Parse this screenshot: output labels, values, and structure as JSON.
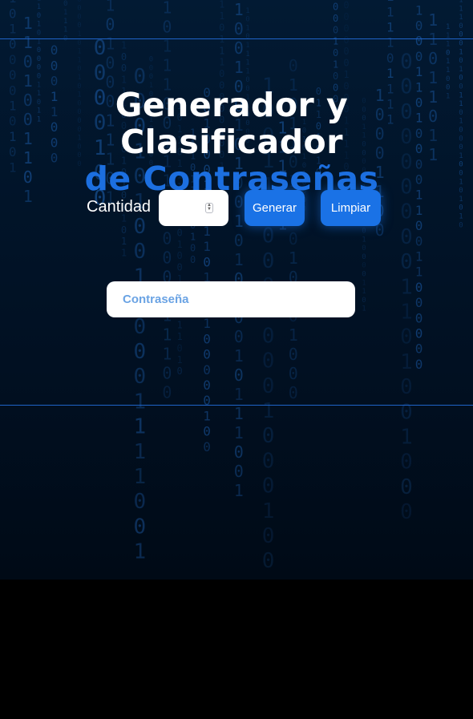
{
  "title": {
    "line1": "Generador y Clasificador",
    "line2": "de Contraseñas"
  },
  "controls": {
    "quantity_label": "Cantidad",
    "quantity_value": "",
    "generate_label": "Generar",
    "clear_label": "Limpiar"
  },
  "password": {
    "placeholder": "Contraseña"
  },
  "colors": {
    "accent": "#1a72e6",
    "background": "#011429",
    "title_blue": "#1c6fe0"
  }
}
